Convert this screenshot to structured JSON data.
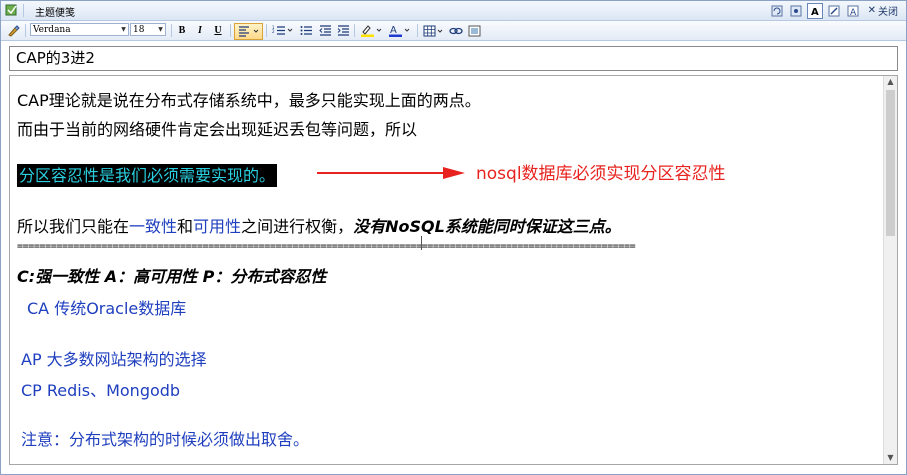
{
  "titlebar": {
    "title": "主题便笺",
    "close_label": "关闭"
  },
  "toolbar": {
    "font_name": "Verdana",
    "font_size": "18",
    "bold": "B",
    "italic": "I",
    "underline": "U"
  },
  "note": {
    "title": "CAP的3进2",
    "line1": "CAP理论就是说在分布式存储系统中，最多只能实现上面的两点。",
    "line2": "而由于当前的网络硬件肯定会出现延迟丢包等问题，所以",
    "highlight": "分区容忍性是我们必须需要实现的。",
    "annotation": "nosql数据库必须实现分区容忍性",
    "line4_a": "所以我们只能在",
    "line4_b": "一致性",
    "line4_c": "和",
    "line4_d": "可用性",
    "line4_e": "之间进行权衡，",
    "line4_f": "没有NoSQL系统能同时保证这三点。",
    "separator": "==============================================================================================================",
    "legend": "C:强一致性  A：高可用性  P：分布式容忍性",
    "ca": "CA 传统Oracle数据库",
    "ap": "AP 大多数网站架构的选择",
    "cp": "CP Redis、Mongodb",
    "note": "注意：分布式架构的时候必须做出取舍。"
  },
  "colors": {
    "annotation_red": "#e8231f",
    "highlight_text": "#2ad0e0",
    "link_blue": "#1f3fbf"
  }
}
